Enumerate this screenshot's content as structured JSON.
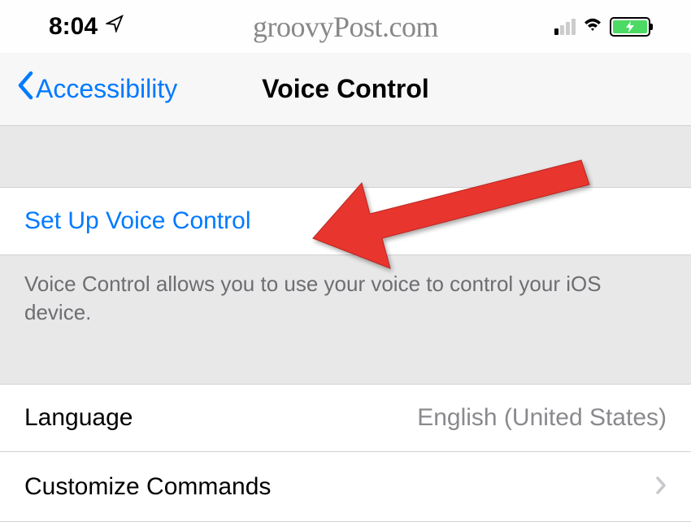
{
  "statusBar": {
    "time": "8:04",
    "watermark": "groovyPost.com"
  },
  "nav": {
    "backLabel": "Accessibility",
    "title": "Voice Control"
  },
  "setup": {
    "label": "Set Up Voice Control",
    "footer": "Voice Control allows you to use your voice to control your iOS device."
  },
  "language": {
    "label": "Language",
    "value": "English (United States)"
  },
  "customize": {
    "label": "Customize Commands"
  }
}
